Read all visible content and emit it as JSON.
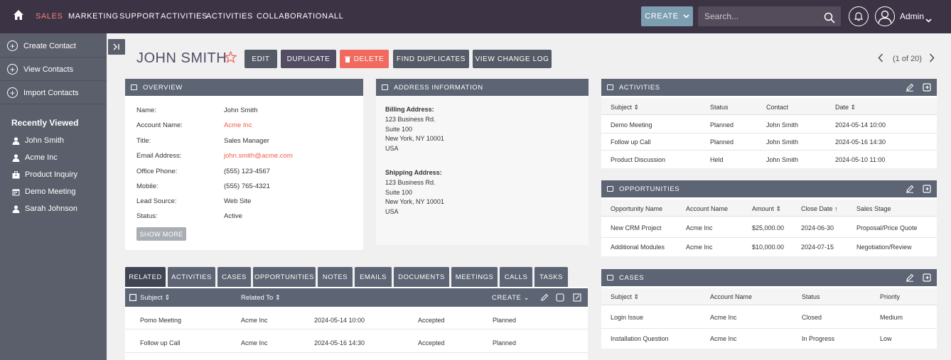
{
  "nav": {
    "items": [
      "SALES",
      "MARKETING",
      "SUPPORT",
      "ACTIVITIES",
      "ACTIVITIES",
      "COLLABORATION",
      "ALL"
    ],
    "create_label": "CREATE",
    "search_placeholder": "Search...",
    "user": "Admin"
  },
  "sidebar": {
    "actions": [
      "Create Contact",
      "View Contacts",
      "Import Contacts"
    ],
    "recent_title": "Recently Viewed",
    "recent": [
      {
        "label": "John Smith",
        "icon": "person-icon"
      },
      {
        "label": "Acme Inc",
        "icon": "person-icon"
      },
      {
        "label": "Product Inquiry",
        "icon": "briefcase-icon"
      },
      {
        "label": "Demo Meeting",
        "icon": "calendar-icon"
      },
      {
        "label": "Sarah Johnson",
        "icon": "person-icon"
      }
    ]
  },
  "record": {
    "name": "JOHN SMITH",
    "buttons": [
      "EDIT",
      "DUPLICATE",
      "DELETE",
      "FIND DUPLICATES",
      "VIEW CHANGE LOG"
    ],
    "pager": "(1 of 20)"
  },
  "overview": {
    "title": "OVERVIEW",
    "fields": [
      {
        "label": "Name:",
        "value": "John Smith",
        "link": false
      },
      {
        "label": "Account Name:",
        "value": "Acme Inc",
        "link": true
      },
      {
        "label": "Title:",
        "value": "Sales Manager",
        "link": false
      },
      {
        "label": "Email Address:",
        "value": "john.smith@acme.com",
        "link": true
      },
      {
        "label": "Office Phone:",
        "value": "(555) 123-4567",
        "link": false
      },
      {
        "label": "Mobile:",
        "value": "(555) 765-4321",
        "link": false
      },
      {
        "label": "Lead Source:",
        "value": "Web Site",
        "link": false
      },
      {
        "label": "Status:",
        "value": "Active",
        "link": false
      }
    ],
    "show_more": "SHOW MORE"
  },
  "address": {
    "title": "ADDRESS INFORMATION",
    "billing_title": "Billing Address:",
    "billing": [
      "123 Business Rd.",
      "Suite 100",
      "New York, NY 10001",
      "USA"
    ],
    "shipping_title": "Shipping Address:",
    "shipping": [
      "123 Business Rd.",
      "Suite 100",
      "New York, NY 10001",
      "USA"
    ]
  },
  "activities": {
    "title": "ACTIVITIES",
    "headers": [
      "Subject",
      "Status",
      "Contact",
      "Date"
    ],
    "rows": [
      [
        "Demo Meeting",
        "Planned",
        "John Smith",
        "2024-05-14 10:00"
      ],
      [
        "Follow up Call",
        "Planned",
        "John Smith",
        "2024-05-16 14:30"
      ],
      [
        "Product Discussion",
        "Held",
        "John Smith",
        "2024-05-10 11:00"
      ]
    ]
  },
  "opportunities": {
    "title": "OPPORTUNITIES",
    "headers": [
      "Opportunity Name",
      "Account Name",
      "Amount",
      "Close Date",
      "Sales Stage"
    ],
    "rows": [
      [
        "New CRM Project",
        "Acme Inc",
        "$25,000.00",
        "2024-06-30",
        "Proposal/Price Quote"
      ],
      [
        "Additional Modules",
        "Acme Inc",
        "$10,000.00",
        "2024-07-15",
        "Negotiation/Review"
      ]
    ]
  },
  "cases": {
    "title": "CASES",
    "headers": [
      "Subject",
      "Account Name",
      "Status",
      "Priority"
    ],
    "rows": [
      [
        "Login Issue",
        "Acme Inc",
        "Closed",
        "Medium"
      ],
      [
        "Installation Question",
        "Acme Inc",
        "In Progress",
        "Low"
      ]
    ]
  },
  "tabs": [
    "RELATED",
    "ACTIVITIES",
    "CASES",
    "OPPORTUNITIES",
    "NOTES",
    "EMAILS",
    "DOCUMENTS",
    "MEETINGS",
    "CALLS",
    "TASKS"
  ],
  "related": {
    "headers": [
      "Subject",
      "Related To"
    ],
    "create_label": "CREATE",
    "rows": [
      [
        "Pomo Meeting",
        "Acme Inc",
        "2024-05-14 10:00",
        "Accepted",
        "Planned"
      ],
      [
        "Follow up Call",
        "Acme Inc",
        "2024-05-16 14:30",
        "Accepted",
        "Planned"
      ]
    ]
  }
}
